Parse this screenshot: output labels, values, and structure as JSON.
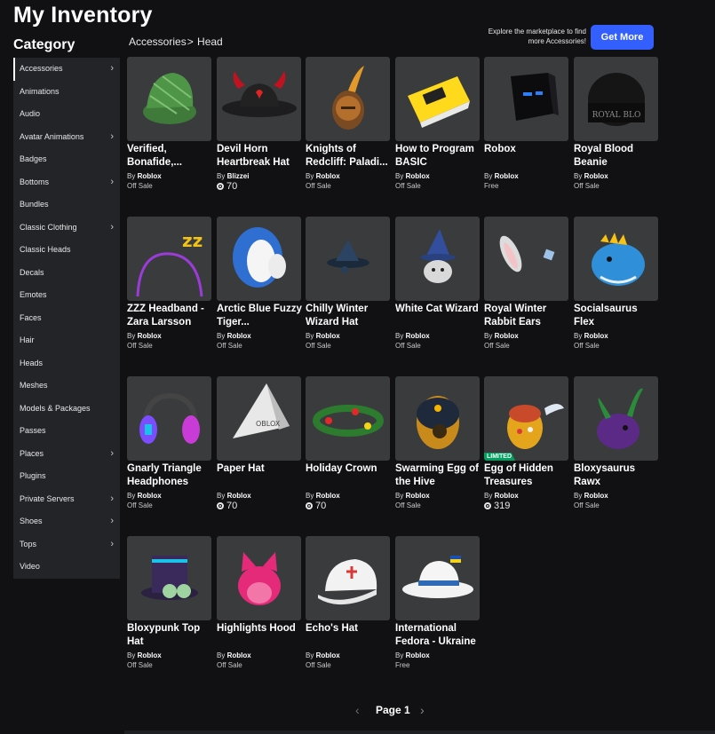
{
  "title": "My Inventory",
  "category_title": "Category",
  "sidebar": [
    {
      "label": "Accessories",
      "chevron": true,
      "active": true
    },
    {
      "label": "Animations",
      "chevron": false
    },
    {
      "label": "Audio",
      "chevron": false
    },
    {
      "label": "Avatar Animations",
      "chevron": true
    },
    {
      "label": "Badges",
      "chevron": false
    },
    {
      "label": "Bottoms",
      "chevron": true
    },
    {
      "label": "Bundles",
      "chevron": false
    },
    {
      "label": "Classic Clothing",
      "chevron": true
    },
    {
      "label": "Classic Heads",
      "chevron": false
    },
    {
      "label": "Decals",
      "chevron": false
    },
    {
      "label": "Emotes",
      "chevron": false
    },
    {
      "label": "Faces",
      "chevron": false
    },
    {
      "label": "Hair",
      "chevron": false
    },
    {
      "label": "Heads",
      "chevron": false
    },
    {
      "label": "Meshes",
      "chevron": false
    },
    {
      "label": "Models & Packages",
      "chevron": false
    },
    {
      "label": "Passes",
      "chevron": false
    },
    {
      "label": "Places",
      "chevron": true
    },
    {
      "label": "Plugins",
      "chevron": false
    },
    {
      "label": "Private Servers",
      "chevron": true
    },
    {
      "label": "Shoes",
      "chevron": true
    },
    {
      "label": "Tops",
      "chevron": true
    },
    {
      "label": "Video",
      "chevron": false
    }
  ],
  "breadcrumb": {
    "parent": "Accessories",
    "separator": ">",
    "current": "Head"
  },
  "promo": {
    "text": "Explore the marketplace to find more Accessories!",
    "button": "Get More"
  },
  "by_label": "By",
  "items": [
    {
      "name": "Verified, Bonafide,...",
      "creator": "Roblox",
      "price": "Off Sale",
      "robux": false,
      "limited": false,
      "icon": "green-plaid-cap-icon"
    },
    {
      "name": "Devil Horn Heartbreak Hat",
      "creator": "Blizzei",
      "price": "70",
      "robux": true,
      "limited": false,
      "icon": "devil-horn-hat-icon"
    },
    {
      "name": "Knights of Redcliff: Paladi...",
      "creator": "Roblox",
      "price": "Off Sale",
      "robux": false,
      "limited": false,
      "icon": "knight-helmet-icon"
    },
    {
      "name": "How to Program BASIC",
      "creator": "Roblox",
      "price": "Off Sale",
      "robux": false,
      "limited": false,
      "icon": "book-hat-icon"
    },
    {
      "name": "Robox",
      "creator": "Roblox",
      "price": "Free",
      "robux": false,
      "limited": false,
      "icon": "robox-head-icon"
    },
    {
      "name": "Royal Blood Beanie",
      "creator": "Roblox",
      "price": "Off Sale",
      "robux": false,
      "limited": false,
      "icon": "beanie-icon"
    },
    {
      "name": "ZZZ Headband - Zara Larsson",
      "creator": "Roblox",
      "price": "Off Sale",
      "robux": false,
      "limited": false,
      "icon": "zzz-headband-icon"
    },
    {
      "name": "Arctic Blue Fuzzy Tiger...",
      "creator": "Roblox",
      "price": "Off Sale",
      "robux": false,
      "limited": false,
      "icon": "tiger-hood-icon"
    },
    {
      "name": "Chilly Winter Wizard Hat",
      "creator": "Roblox",
      "price": "Off Sale",
      "robux": false,
      "limited": false,
      "icon": "wizard-hat-icon"
    },
    {
      "name": "White Cat Wizard",
      "creator": "Roblox",
      "price": "Off Sale",
      "robux": false,
      "limited": false,
      "icon": "cat-wizard-icon"
    },
    {
      "name": "Royal Winter Rabbit Ears",
      "creator": "Roblox",
      "price": "Off Sale",
      "robux": false,
      "limited": false,
      "icon": "rabbit-ears-icon"
    },
    {
      "name": "Socialsaurus Flex",
      "creator": "Roblox",
      "price": "Off Sale",
      "robux": false,
      "limited": false,
      "icon": "dino-hat-icon"
    },
    {
      "name": "Gnarly Triangle Headphones",
      "creator": "Roblox",
      "price": "Off Sale",
      "robux": false,
      "limited": false,
      "icon": "headphones-icon"
    },
    {
      "name": "Paper Hat",
      "creator": "Roblox",
      "price": "70",
      "robux": true,
      "limited": false,
      "icon": "paper-hat-icon"
    },
    {
      "name": "Holiday Crown",
      "creator": "Roblox",
      "price": "70",
      "robux": true,
      "limited": false,
      "icon": "holiday-crown-icon"
    },
    {
      "name": "Swarming Egg of the Hive",
      "creator": "Roblox",
      "price": "Off Sale",
      "robux": false,
      "limited": false,
      "icon": "hive-egg-icon"
    },
    {
      "name": "Egg of Hidden Treasures",
      "creator": "Roblox",
      "price": "319",
      "robux": true,
      "limited": true,
      "icon": "treasure-egg-icon"
    },
    {
      "name": "Bloxysaurus Rawx",
      "creator": "Roblox",
      "price": "Off Sale",
      "robux": false,
      "limited": false,
      "icon": "purple-dino-icon"
    },
    {
      "name": "Bloxypunk Top Hat",
      "creator": "Roblox",
      "price": "Off Sale",
      "robux": false,
      "limited": false,
      "icon": "top-hat-icon"
    },
    {
      "name": "Highlights Hood",
      "creator": "Roblox",
      "price": "Off Sale",
      "robux": false,
      "limited": false,
      "icon": "cat-hood-icon"
    },
    {
      "name": "Echo's Hat",
      "creator": "Roblox",
      "price": "Off Sale",
      "robux": false,
      "limited": false,
      "icon": "baseball-cap-icon"
    },
    {
      "name": "International Fedora - Ukraine",
      "creator": "Roblox",
      "price": "Free",
      "robux": false,
      "limited": false,
      "icon": "fedora-icon"
    }
  ],
  "limited_label": "LIMITED",
  "pager": {
    "label": "Page 1",
    "prev": "‹",
    "next": "›"
  }
}
